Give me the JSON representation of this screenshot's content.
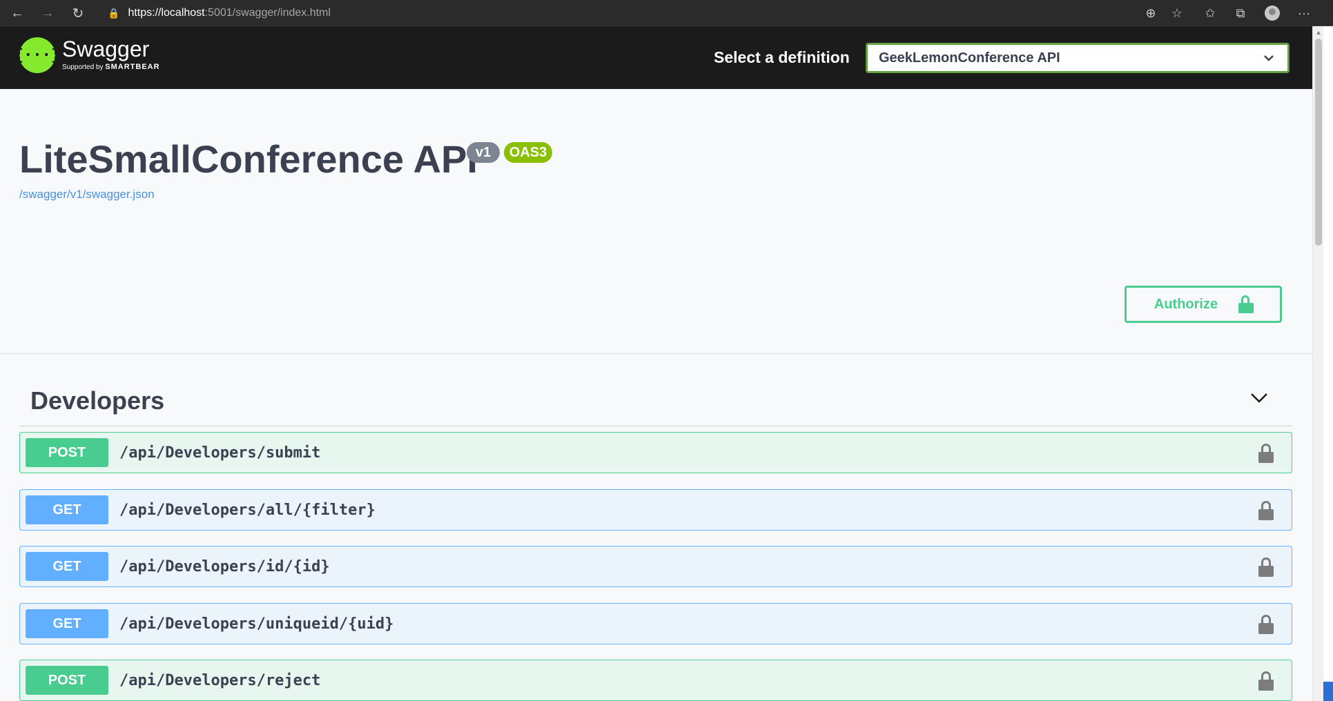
{
  "browser": {
    "url_host": "https://localhost",
    "url_path": ":5001/swagger/index.html",
    "back_icon": "←",
    "forward_icon": "→",
    "refresh_icon": "↻",
    "lock_icon": "🔒",
    "zoom_icon": "⊕",
    "fav_add_icon": "☆",
    "favorites_icon": "✩",
    "collections_icon": "⧉",
    "more_icon": "···"
  },
  "topbar": {
    "logo_mark": "{···}",
    "logo_name": "Swagger",
    "logo_sub_prefix": "Supported by ",
    "logo_sub_brand": "SMARTBEAR",
    "definition_label": "Select a definition",
    "definition_selected": "GeekLemonConference API"
  },
  "info": {
    "title": "LiteSmallConference API",
    "version": "v1",
    "oas_badge": "OAS3",
    "spec_link": "/swagger/v1/swagger.json"
  },
  "authorize": {
    "label": "Authorize"
  },
  "tag": {
    "name": "Developers",
    "operations": [
      {
        "method": "POST",
        "path": "/api/Developers/submit"
      },
      {
        "method": "GET",
        "path": "/api/Developers/all/{filter}"
      },
      {
        "method": "GET",
        "path": "/api/Developers/id/{id}"
      },
      {
        "method": "GET",
        "path": "/api/Developers/uniqueid/{uid}"
      },
      {
        "method": "POST",
        "path": "/api/Developers/reject"
      }
    ]
  },
  "colors": {
    "post": "#49cc90",
    "get": "#61affe",
    "swagger_green": "#85ea2d",
    "text": "#3b4151"
  }
}
